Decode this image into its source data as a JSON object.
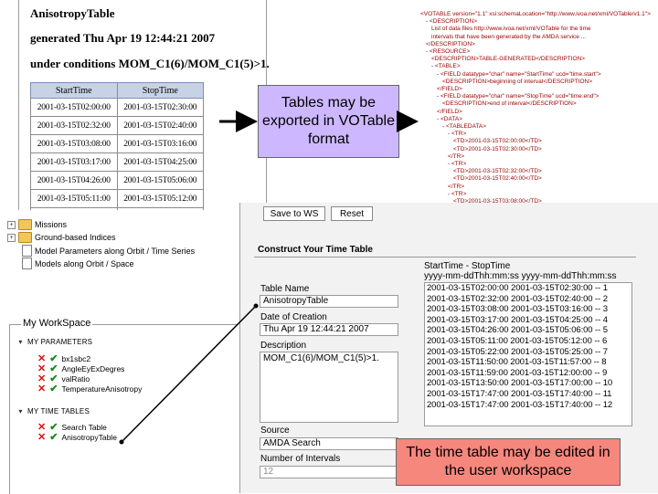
{
  "anisotropy": {
    "title": "AnisotropyTable",
    "generated": "generated Thu Apr 19 12:44:21 2007",
    "conditions": "under conditions MOM_C1(6)/MOM_C1(5)>1.",
    "columns": [
      "StartTime",
      "StopTime"
    ],
    "rows": [
      [
        "2001-03-15T02:00:00",
        "2001-03-15T02:30:00"
      ],
      [
        "2001-03-15T02:32:00",
        "2001-03-15T02:40:00"
      ],
      [
        "2001-03-15T03:08:00",
        "2001-03-15T03:16:00"
      ],
      [
        "2001-03-15T03:17:00",
        "2001-03-15T04:25:00"
      ],
      [
        "2001-03-15T04:26:00",
        "2001-03-15T05:06:00"
      ],
      [
        "2001-03-15T05:11:00",
        "2001-03-15T05:12:00"
      ],
      [
        "2001-03-15T05:22:00",
        "2001-03-15T05:25:00"
      ]
    ]
  },
  "callouts": {
    "export": "Tables may be exported in VOTable format",
    "edit": "The time table may be edited in the user workspace"
  },
  "xml": {
    "lines": [
      {
        "indent": 0,
        "m": "",
        "text": "<VOTABLE version=\"1.1\" xsi:schemaLocation=\"http://www.ivoa.net/xml/VOTable/v1.1\">"
      },
      {
        "indent": 1,
        "m": "-",
        "text": "<DESCRIPTION>"
      },
      {
        "indent": 2,
        "m": "",
        "text": "List of data files http://www.ivoa.net/xml/VOTable for the time"
      },
      {
        "indent": 2,
        "m": "",
        "text": "intervals that have been generated by the AMDA service ... "
      },
      {
        "indent": 1,
        "m": "",
        "text": "</DESCRIPTION>"
      },
      {
        "indent": 1,
        "m": "-",
        "text": "<RESOURCE>"
      },
      {
        "indent": 2,
        "m": "",
        "text": "<DESCRIPTION>TABLE-GENERATED</DESCRIPTION>"
      },
      {
        "indent": 2,
        "m": "-",
        "text": "<TABLE>"
      },
      {
        "indent": 3,
        "m": "-",
        "text": "<FIELD datatype=\"char\" name=\"StartTime\" ucd=\"time.start\">"
      },
      {
        "indent": 4,
        "m": "",
        "text": "<DESCRIPTION>beginning of interval</DESCRIPTION>"
      },
      {
        "indent": 3,
        "m": "",
        "text": "</FIELD>"
      },
      {
        "indent": 3,
        "m": "-",
        "text": "<FIELD datatype=\"char\" name=\"StopTime\" ucd=\"time.end\">"
      },
      {
        "indent": 4,
        "m": "",
        "text": "<DESCRIPTION>end of interval</DESCRIPTION>"
      },
      {
        "indent": 3,
        "m": "",
        "text": "</FIELD>"
      },
      {
        "indent": 3,
        "m": "-",
        "text": "<DATA>"
      },
      {
        "indent": 4,
        "m": "-",
        "text": "<TABLEDATA>"
      },
      {
        "indent": 5,
        "m": "-",
        "text": "<TR>"
      },
      {
        "indent": 6,
        "m": "",
        "text": "<TD>2001-03-15T02:00:00</TD>"
      },
      {
        "indent": 6,
        "m": "",
        "text": "<TD>2001-03-15T02:30:00</TD>"
      },
      {
        "indent": 5,
        "m": "",
        "text": "</TR>"
      },
      {
        "indent": 5,
        "m": "-",
        "text": "<TR>"
      },
      {
        "indent": 6,
        "m": "",
        "text": "<TD>2001-03-15T02:32:00</TD>"
      },
      {
        "indent": 6,
        "m": "",
        "text": "<TD>2001-03-15T02:40:00</TD>"
      },
      {
        "indent": 5,
        "m": "",
        "text": "</TR>"
      },
      {
        "indent": 5,
        "m": "-",
        "text": "<TR>"
      },
      {
        "indent": 6,
        "m": "",
        "text": "<TD>2001-03-15T03:08:00</TD>"
      },
      {
        "indent": 6,
        "m": "",
        "text": "<TD>2001-03-15T03:16:00</TD>"
      },
      {
        "indent": 5,
        "m": "",
        "text": "</TR>"
      },
      {
        "indent": 5,
        "m": "-",
        "text": "<TR>"
      },
      {
        "indent": 6,
        "m": "",
        "text": "<TD>2001-03-15T03:17:00</TD>"
      },
      {
        "indent": 6,
        "m": "",
        "text": "<TD>2001-03-15T04:25:00</TD>"
      }
    ]
  },
  "tree": {
    "items": [
      {
        "label": "Missions",
        "kind": "folder",
        "expander": "+"
      },
      {
        "label": "Ground-based Indices",
        "kind": "folder",
        "expander": "+"
      },
      {
        "label": "Model Parameters along Orbit / Time Series",
        "kind": "doc",
        "expander": ""
      },
      {
        "label": "Models along Orbit / Space",
        "kind": "doc",
        "expander": ""
      }
    ]
  },
  "workspace": {
    "title": "My WorkSpace",
    "params_label": "MY PARAMETERS",
    "params": [
      "bx1sbc2",
      "AngleEyExDegres",
      "valRatio",
      "TemperatureAnisotropy"
    ],
    "timetables_label": "MY TIME TABLES",
    "timetables": [
      "Search Table",
      "AnisotropyTable"
    ]
  },
  "form": {
    "save_label": "Save to WS",
    "reset_label": "Reset",
    "construct_title": "Construct Your Time Table",
    "table_name_label": "Table Name",
    "table_name_value": "AnisotropyTable",
    "date_label": "Date of Creation",
    "date_value": "Thu Apr 19 12:44:21 2007",
    "description_label": "Description",
    "description_value": "MOM_C1(6)/MOM_C1(5)>1.",
    "source_label": "Source",
    "source_value": "AMDA Search",
    "intervals_label": "Number of Intervals",
    "intervals_value": "12",
    "start_stop_header": "StartTime - StopTime",
    "format_header": "yyyy-mm-ddThh:mm:ss yyyy-mm-ddThh:mm:ss",
    "intervals": [
      "2001-03-15T02:00:00 2001-03-15T02:30:00 -- 1",
      "2001-03-15T02:32:00 2001-03-15T02:40:00 -- 2",
      "2001-03-15T03:08:00 2001-03-15T03:16:00 -- 3",
      "2001-03-15T03:17:00 2001-03-15T04:25:00 -- 4",
      "2001-03-15T04:26:00 2001-03-15T05:06:00 -- 5",
      "2001-03-15T05:11:00 2001-03-15T05:12:00 -- 6",
      "2001-03-15T05:22:00 2001-03-15T05:25:00 -- 7",
      "2001-03-15T11:50:00 2001-03-15T11:57:00 -- 8",
      "2001-03-15T11:59:00 2001-03-15T12:00:00 -- 9",
      "2001-03-15T13:50:00 2001-03-15T17:00:00 -- 10",
      "2001-03-15T17:47:00 2001-03-15T17:40:00 -- 11",
      "2001-03-15T17:47:00 2001-03-15T17:40:00 -- 12"
    ]
  },
  "colors": {
    "export_callout": "#cdb8ff",
    "edit_callout": "#f5877d",
    "table_header": "#c8d2e6",
    "check": "#1a8a1a",
    "cross": "#d81313"
  }
}
